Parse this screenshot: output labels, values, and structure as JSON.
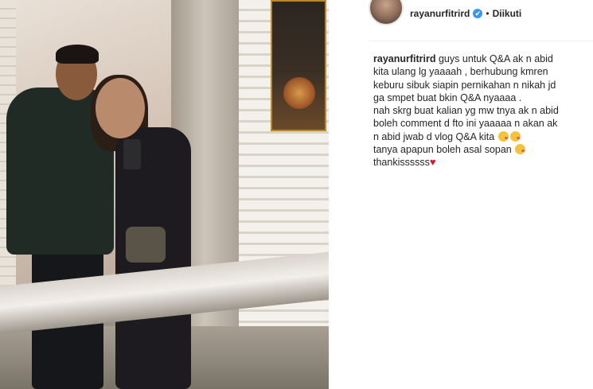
{
  "post": {
    "username": "rayanurfitrird",
    "follow_status": "Diikuti",
    "separator": "•",
    "verified_glyph": "✔",
    "caption_lines": [
      "guys untuk Q&A ak n abid",
      "kita ulang lg yaaaah , berhubung kmren",
      "keburu sibuk siapin pernikahan n nikah jd",
      "ga smpet buat bkin Q&A nyaaaa .",
      "nah skrg buat kalian yg mw tnya ak n abid",
      "boleh comment d fto ini yaaaaa n akan ak",
      "n abid jwab d vlog Q&A kita",
      "tanya apapun boleh asal sopan",
      "thankissssss"
    ],
    "heart_glyph": "♥",
    "icons": {
      "verified": "verified-badge-icon",
      "emoji": "kiss-face-emoji-icon",
      "heart": "red-heart-emoji-icon"
    },
    "colors": {
      "verified_blue": "#3897f0",
      "text": "#262626",
      "heart_red": "#d7192f"
    }
  }
}
